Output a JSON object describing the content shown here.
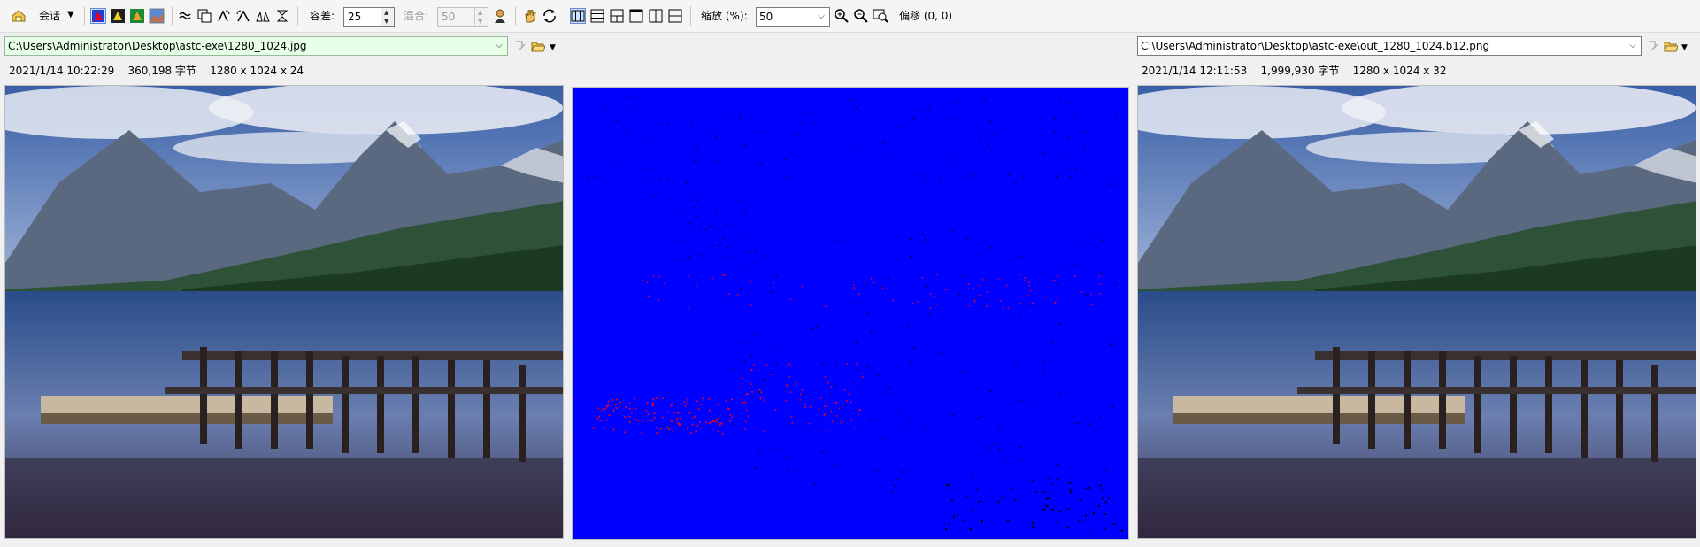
{
  "toolbar": {
    "session_label": "会话",
    "tolerance_label": "容差:",
    "tolerance_value": "25",
    "blend_label": "混合:",
    "blend_value": "50",
    "zoom_label": "缩放 (%):",
    "zoom_value": "50",
    "offset_label": "偏移 (0, 0)"
  },
  "left_pane": {
    "path": "C:\\Users\\Administrator\\Desktop\\astc-exe\\1280_1024.jpg",
    "info": "2021/1/14 10:22:29    360,198 字节    1280 x 1024 x 24"
  },
  "right_pane": {
    "path": "C:\\Users\\Administrator\\Desktop\\astc-exe\\out_1280_1024.b12.png",
    "info": "2021/1/14 12:11:53    1,999,930 字节    1280 x 1024 x 32"
  },
  "colors": {
    "diff_background": "#0000ff",
    "diff_marks": "#e8001e",
    "path_highlight": "#e6ffe6"
  }
}
